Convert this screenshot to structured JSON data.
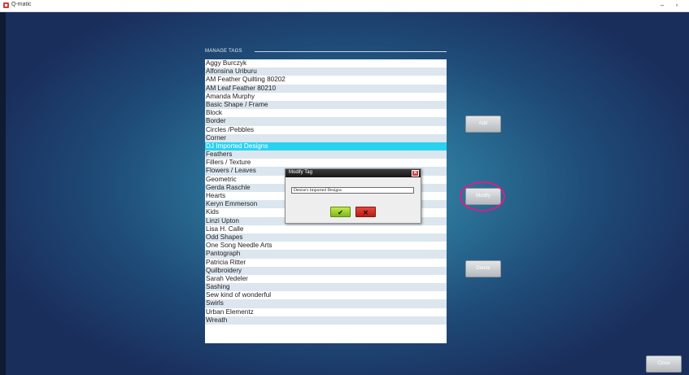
{
  "window": {
    "title": "Q-matic",
    "minimize": "–",
    "maximize": "▫"
  },
  "section": {
    "label": "MANAGE TAGS"
  },
  "tags": [
    "Aggy Burczyk",
    "Alfonsina Uriburu",
    "AM Feather Quilting 80202",
    "AM Leaf Feather 80210",
    "Amanda Murphy",
    "Basic Shape / Frame",
    "Block",
    "Border",
    "Circles /Pebbles",
    "Corner",
    "DJ Imported Designs",
    "Feathers",
    "Fillers / Texture",
    "Flowers / Leaves",
    "Geometric",
    "Gerda Raschle",
    "Hearts",
    "Keryn Emmerson",
    "Kids",
    "Linzi Upton",
    "Lisa H. Calle",
    "Odd Shapes",
    "One Song Needle Arts",
    "Pantograph",
    "Patricia Ritter",
    "Quilbroidery",
    "Sarah Vedeler",
    "Sashing",
    "Sew kind of wonderful",
    "Swirls",
    "Urban Elementz",
    "Wreath"
  ],
  "selected_tag": "DJ Imported Designs",
  "buttons": {
    "add": "Add",
    "modify": "Modify",
    "delete": "Delete",
    "close": "Close"
  },
  "dialog": {
    "title": "Modify Tag",
    "close_glyph": "✕",
    "input_value": "Denise's Imported Designs",
    "ok_glyph": "✔",
    "cancel_glyph": "✕"
  },
  "colors": {
    "selection": "#29d3f0",
    "highlight_ring": "#d6208a",
    "ok_green": "#7fb81c",
    "cancel_red": "#b41f17"
  }
}
